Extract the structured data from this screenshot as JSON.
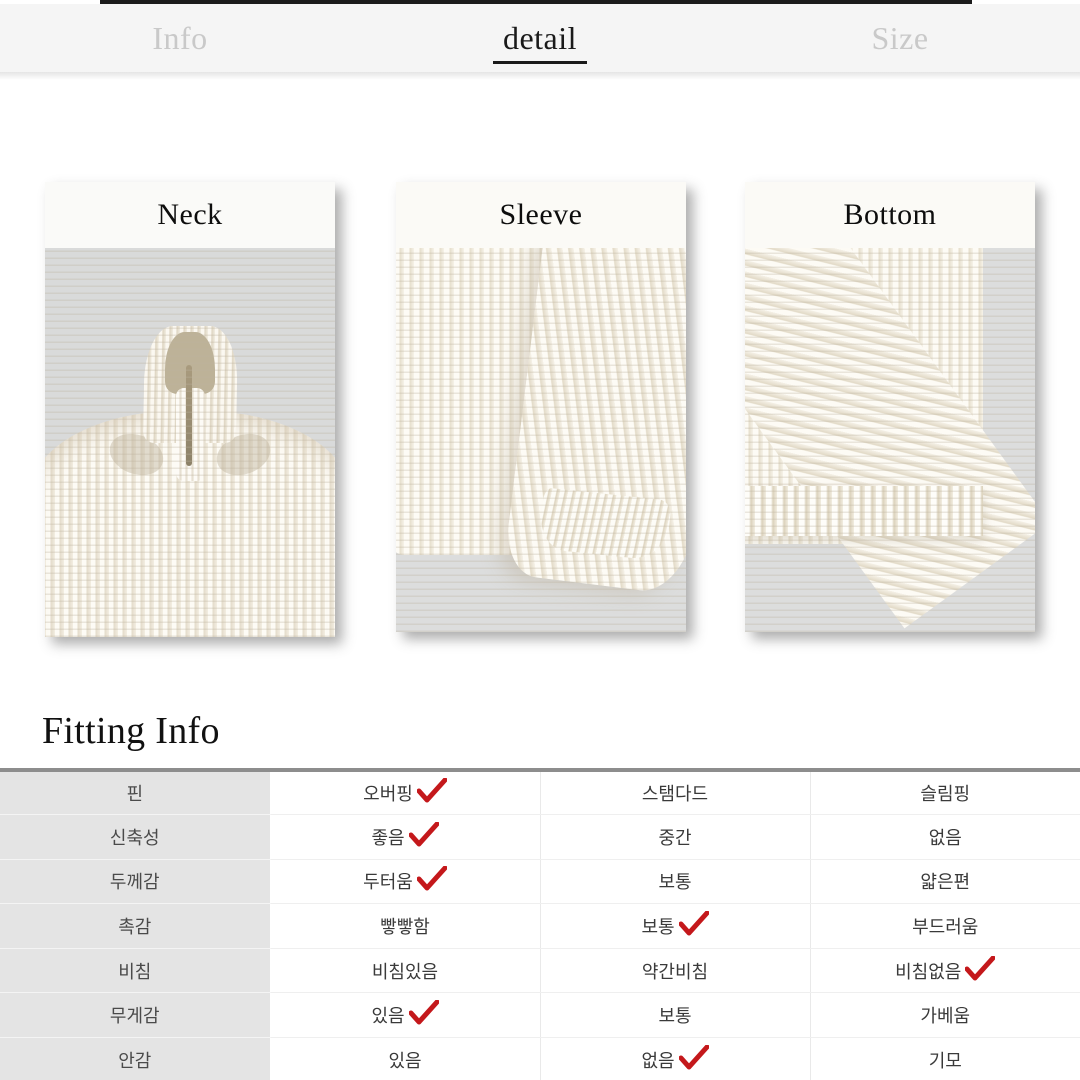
{
  "tabs": [
    {
      "label": "Info",
      "active": false
    },
    {
      "label": "detail",
      "active": true
    },
    {
      "label": "Size",
      "active": false
    }
  ],
  "detail_cards": [
    {
      "title": "Neck",
      "photo": "mock-neck-half-zip-ribbed-knit-cream"
    },
    {
      "title": "Sleeve",
      "photo": "ribbed-knit-sleeve-cuff-cream"
    },
    {
      "title": "Bottom",
      "photo": "ribbed-knit-bottom-hem-cream"
    }
  ],
  "fitting": {
    "heading": "Fitting Info",
    "rows": [
      {
        "label": "핀",
        "options": [
          {
            "text": "오버핑",
            "checked": true
          },
          {
            "text": "스탬다드",
            "checked": false
          },
          {
            "text": "슬림핑",
            "checked": false
          }
        ]
      },
      {
        "label": "신축성",
        "options": [
          {
            "text": "좋음",
            "checked": true
          },
          {
            "text": "중간",
            "checked": false
          },
          {
            "text": "없음",
            "checked": false
          }
        ]
      },
      {
        "label": "두께감",
        "options": [
          {
            "text": "두터움",
            "checked": true
          },
          {
            "text": "보통",
            "checked": false
          },
          {
            "text": "얇은편",
            "checked": false
          }
        ]
      },
      {
        "label": "촉감",
        "options": [
          {
            "text": "빻빻함",
            "checked": false
          },
          {
            "text": "보통",
            "checked": true
          },
          {
            "text": "부드러움",
            "checked": false
          }
        ]
      },
      {
        "label": "비침",
        "options": [
          {
            "text": "비침있음",
            "checked": false
          },
          {
            "text": "약간비침",
            "checked": false
          },
          {
            "text": "비침없음",
            "checked": true
          }
        ]
      },
      {
        "label": "무게감",
        "options": [
          {
            "text": "있음",
            "checked": true
          },
          {
            "text": "보통",
            "checked": false
          },
          {
            "text": "가베움",
            "checked": false
          }
        ]
      },
      {
        "label": "안감",
        "options": [
          {
            "text": "있음",
            "checked": false
          },
          {
            "text": "없음",
            "checked": true
          },
          {
            "text": "기모",
            "checked": false
          }
        ]
      }
    ]
  },
  "colors": {
    "check_mark": "#C4181B",
    "tab_active_text": "#1a1a1a",
    "tab_inactive_text": "#c9c9c9",
    "tab_bar_bg": "#f5f5f5",
    "table_label_bg": "#e4e4e4",
    "table_top_border": "#8d8d8d",
    "knit_cream": "#f6f1e6",
    "photo_bg_grey": "#d9dada"
  }
}
